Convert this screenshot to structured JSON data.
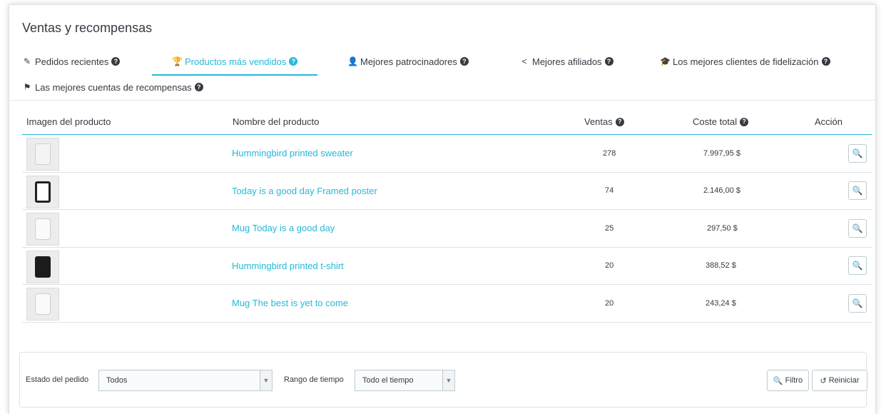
{
  "card": {
    "title": "Ventas y recompensas"
  },
  "tabs": [
    {
      "label": "Pedidos recientes",
      "icon": "pen-icon"
    },
    {
      "label": "Productos más vendidos",
      "icon": "trophy-icon"
    },
    {
      "label": "Mejores patrocinadores",
      "icon": "user-icon"
    },
    {
      "label": "Mejores afiliados",
      "icon": "share-icon"
    },
    {
      "label": "Los mejores clientes de fidelización",
      "icon": "graduation-cap-icon"
    },
    {
      "label": "Las mejores cuentas de recompensas",
      "icon": "flag-icon"
    }
  ],
  "table": {
    "headers": {
      "image": "Imagen del producto",
      "name": "Nombre del producto",
      "sales": "Ventas",
      "total": "Coste total",
      "action": "Acción"
    },
    "rows": [
      {
        "name": "Hummingbird printed sweater",
        "sales": "278",
        "total": "7.997,95 $"
      },
      {
        "name": "Today is a good day Framed poster",
        "sales": "74",
        "total": "2.146,00 $"
      },
      {
        "name": "Mug Today is a good day",
        "sales": "25",
        "total": "297,50 $"
      },
      {
        "name": "Hummingbird printed t-shirt",
        "sales": "20",
        "total": "388,52 $"
      },
      {
        "name": "Mug The best is yet to come",
        "sales": "20",
        "total": "243,24 $"
      }
    ]
  },
  "filter": {
    "order_status_label": "Estado del pedido",
    "order_status_value": "Todos",
    "time_range_label": "Rango de tiempo",
    "time_range_value": "Todo el tiempo",
    "filter_button": "Filtro",
    "reset_button": "Reiniciar"
  },
  "colors": {
    "accent": "#25b9d7",
    "text": "#363a41",
    "border": "#bbcdd2"
  }
}
